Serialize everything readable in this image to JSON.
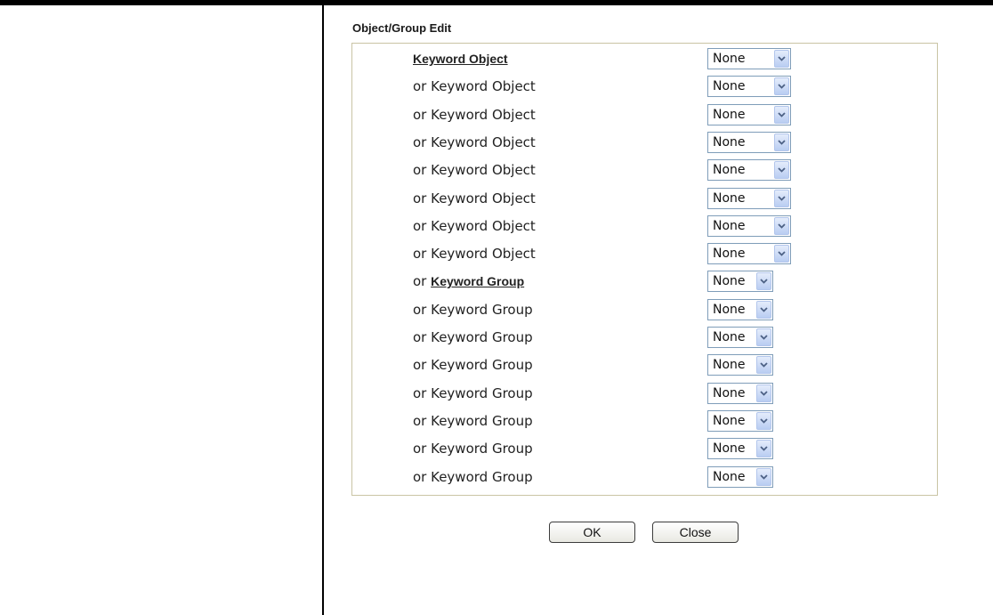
{
  "section_title": "Object/Group Edit",
  "rows": [
    {
      "prefix": "",
      "label": "Keyword Object",
      "link": true,
      "value": "None",
      "kind": "obj"
    },
    {
      "prefix": "",
      "label": "or Keyword Object",
      "link": false,
      "value": "None",
      "kind": "obj"
    },
    {
      "prefix": "",
      "label": "or Keyword Object",
      "link": false,
      "value": "None",
      "kind": "obj"
    },
    {
      "prefix": "",
      "label": "or Keyword Object",
      "link": false,
      "value": "None",
      "kind": "obj"
    },
    {
      "prefix": "",
      "label": "or Keyword Object",
      "link": false,
      "value": "None",
      "kind": "obj"
    },
    {
      "prefix": "",
      "label": "or Keyword Object",
      "link": false,
      "value": "None",
      "kind": "obj"
    },
    {
      "prefix": "",
      "label": "or Keyword Object",
      "link": false,
      "value": "None",
      "kind": "obj"
    },
    {
      "prefix": "",
      "label": "or Keyword Object",
      "link": false,
      "value": "None",
      "kind": "obj"
    },
    {
      "prefix": "or",
      "label": "Keyword Group",
      "link": true,
      "value": "None",
      "kind": "grp"
    },
    {
      "prefix": "",
      "label": "or Keyword Group",
      "link": false,
      "value": "None",
      "kind": "grp"
    },
    {
      "prefix": "",
      "label": "or Keyword Group",
      "link": false,
      "value": "None",
      "kind": "grp"
    },
    {
      "prefix": "",
      "label": "or Keyword Group",
      "link": false,
      "value": "None",
      "kind": "grp"
    },
    {
      "prefix": "",
      "label": "or Keyword Group",
      "link": false,
      "value": "None",
      "kind": "grp"
    },
    {
      "prefix": "",
      "label": "or Keyword Group",
      "link": false,
      "value": "None",
      "kind": "grp"
    },
    {
      "prefix": "",
      "label": "or Keyword Group",
      "link": false,
      "value": "None",
      "kind": "grp"
    },
    {
      "prefix": "",
      "label": "or Keyword Group",
      "link": false,
      "value": "None",
      "kind": "grp"
    }
  ],
  "buttons": {
    "ok": "OK",
    "close": "Close"
  },
  "icons": {
    "dropdown": "chevron-down-icon"
  }
}
